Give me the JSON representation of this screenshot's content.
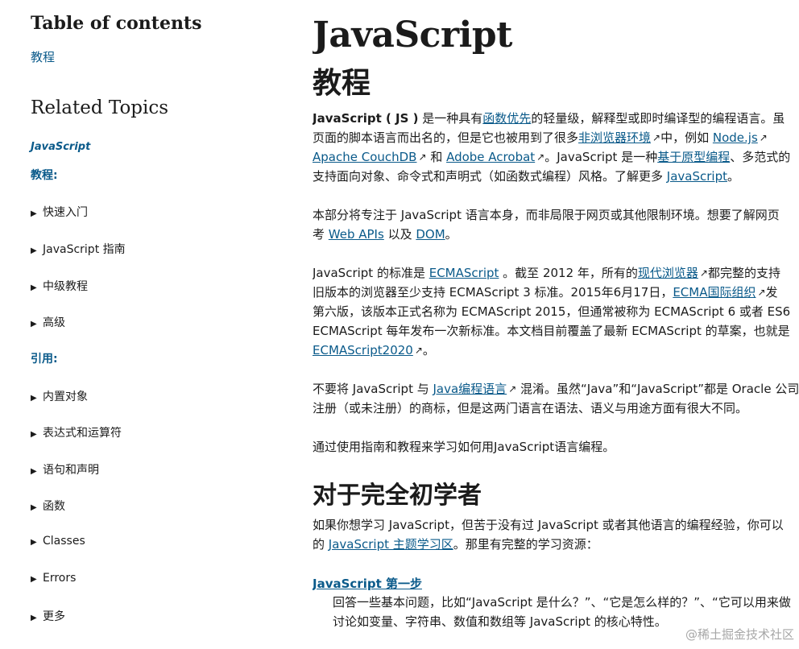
{
  "sidebar": {
    "toc_title": "Table of contents",
    "toc_link": "教程",
    "related_title": "Related Topics",
    "related_current": "JavaScript",
    "group_tutorials": "教程:",
    "tutorial_items": [
      "快速入门",
      "JavaScript 指南",
      "中级教程",
      "高级"
    ],
    "group_reference": "引用:",
    "reference_items": [
      "内置对象",
      "表达式和运算符",
      "语句和声明",
      "函数",
      "Classes",
      "Errors",
      "更多"
    ]
  },
  "main": {
    "heading": "JavaScript",
    "subheading": "教程",
    "p1": {
      "l1a": "JavaScript ( JS )",
      "l1b": " 是一种具有",
      "l1_link": "函数优先",
      "l1c": "的轻量级，解释型或即时编译型的编程语言。虽",
      "l2a": "页面的脚本语言而出名的，但是它也被用到了很多",
      "l2_link1": "非浏览器环境",
      "l2b": "中，例如 ",
      "l2_link2": "Node.js",
      "l3_link1": "Apache CouchDB",
      "l3a": " 和 ",
      "l3_link2": "Adobe Acrobat",
      "l3b": "。JavaScript 是一种",
      "l3_link3": "基于原型编程",
      "l3c": "、多范式的",
      "l4a": "支持面向对象、命令式和声明式（如函数式编程）风格。了解更多 ",
      "l4_link": "JavaScript",
      "l4b": "。"
    },
    "p2": {
      "l1": "本部分将专注于 JavaScript 语言本身，而非局限于网页或其他限制环境。想要了解网页",
      "l2a": "考 ",
      "l2_link1": "Web APIs",
      "l2b": " 以及 ",
      "l2_link2": "DOM",
      "l2c": "。"
    },
    "p3": {
      "l1a": "JavaScript 的标准是 ",
      "l1_link1": "ECMAScript",
      "l1b": " 。截至 2012 年，所有的",
      "l1_link2": "现代浏览器",
      "l1c": "都完整的支持",
      "l2a": "旧版本的浏览器至少支持 ECMAScript 3 标准。2015年6月17日，",
      "l2_link": "ECMA国际组织",
      "l2b": "发",
      "l3": "第六版，该版本正式名称为 ECMAScript 2015，但通常被称为 ECMAScript 6 或者 ES6",
      "l4": "ECMAScript 每年发布一次新标准。本文档目前覆盖了最新 ECMAScript 的草案，也就是",
      "l5_link": "ECMAScript2020",
      "l5a": "。"
    },
    "p4": {
      "l1a": "不要将 JavaScript 与 ",
      "l1_link": "Java编程语言",
      "l1b": " 混淆。虽然“Java”和“JavaScript”都是 Oracle 公司",
      "l2": "注册（或未注册）的商标，但是这两门语言在语法、语义与用途方面有很大不同。"
    },
    "p5": "通过使用指南和教程来学习如何用JavaScript语言编程。",
    "section_heading": "对于完全初学者",
    "p6": {
      "l1": "如果你想学习 JavaScript，但苦于没有过 JavaScript 或者其他语言的编程经验，你可以",
      "l2a": "的 ",
      "l2_link": "JavaScript 主题学习区",
      "l2b": "。那里有完整的学习资源："
    },
    "dl_term": "JavaScript 第一步",
    "dl_desc_l1": "回答一些基本问题，比如“JavaScript 是什么？”、“它是怎么样的？”、“它可以用来做",
    "dl_desc_l2": "讨论如变量、字符串、数值和数组等 JavaScript 的核心特性。"
  },
  "watermark": "@稀土掘金技术社区",
  "icons": {
    "external_link": "↗",
    "disclosure": "▶"
  },
  "colors": {
    "link": "#0a5a8a",
    "text": "#1b1b1b",
    "watermark": "#a7a7a7"
  }
}
